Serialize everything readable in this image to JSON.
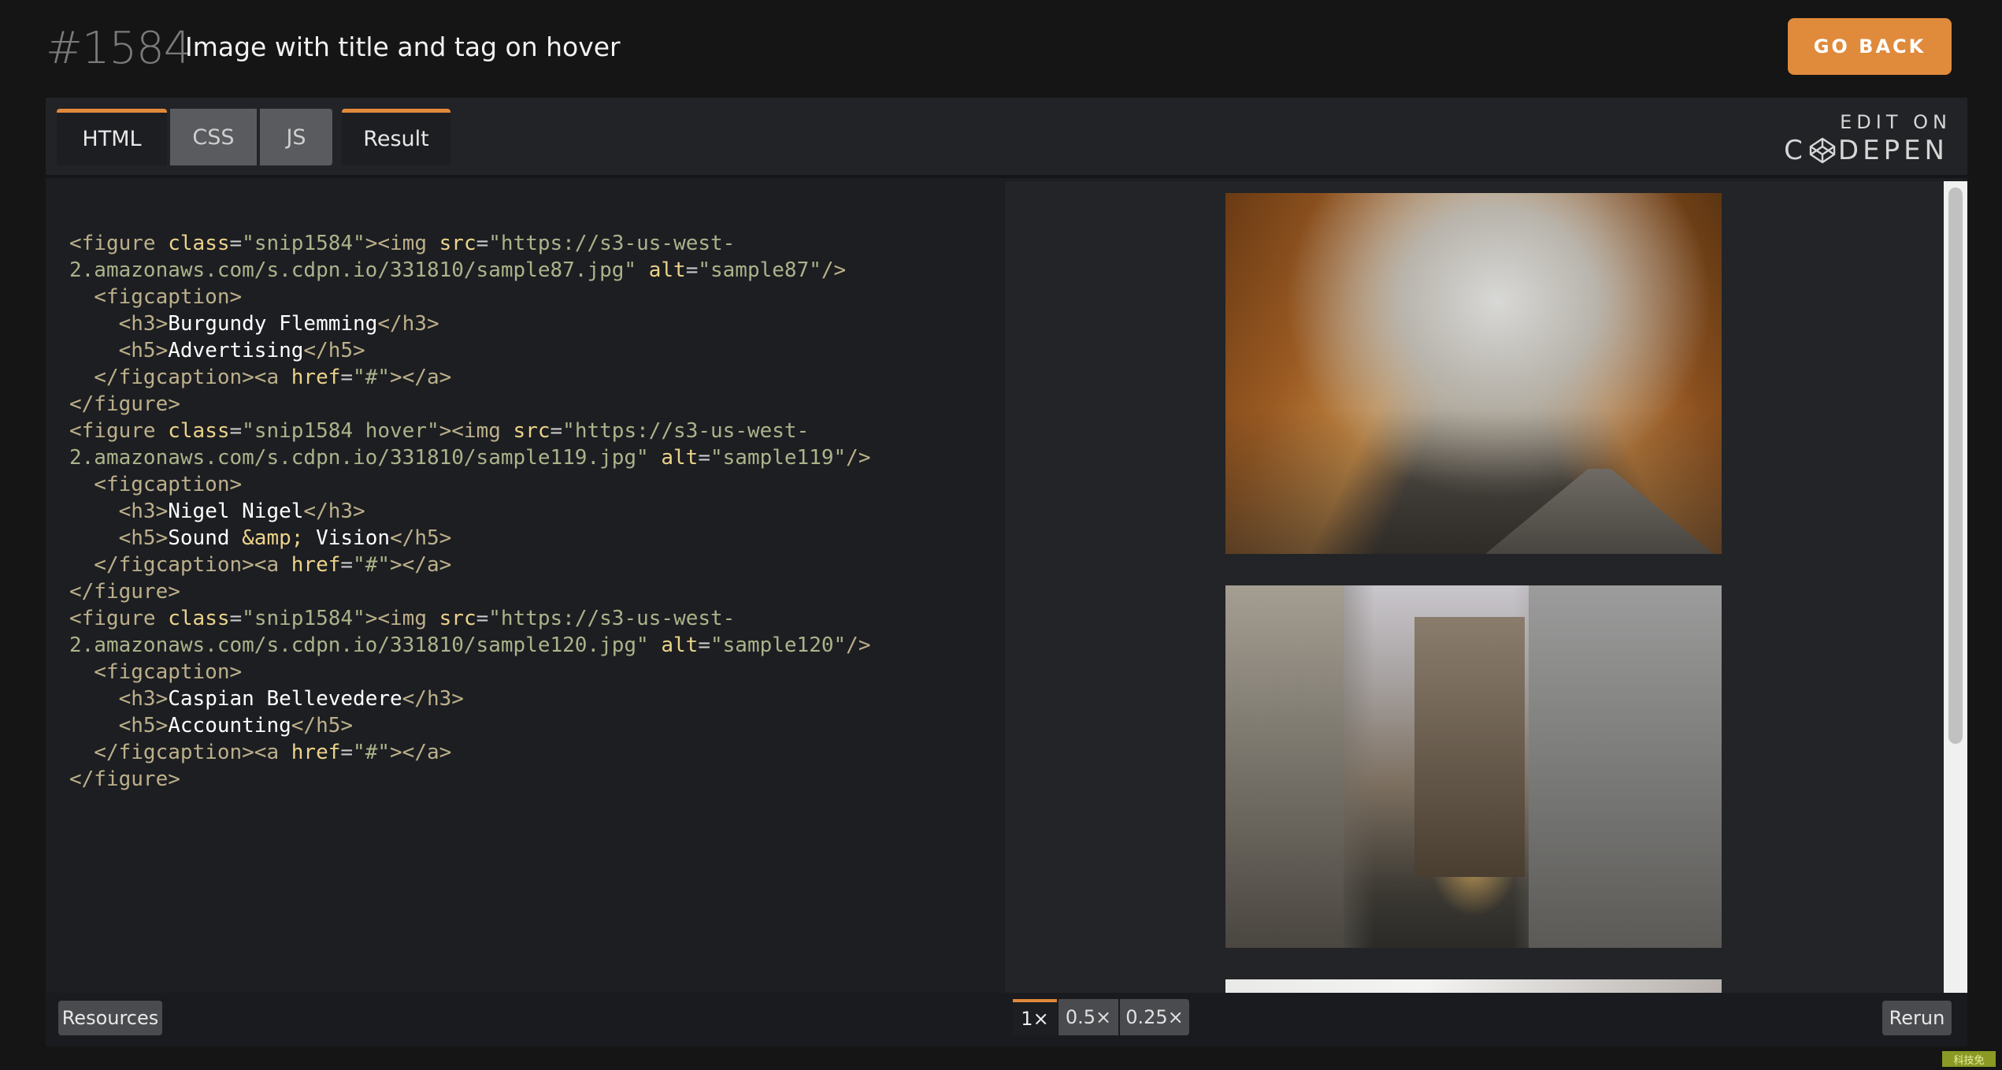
{
  "header": {
    "snippet_number": "#1584",
    "title": "Image with title and tag on hover",
    "go_back_label": "GO BACK"
  },
  "colors": {
    "accent": "#e08a3c",
    "background": "#151515",
    "panel": "#1d1e22"
  },
  "editor": {
    "tabs": [
      {
        "label": "HTML",
        "active": true
      },
      {
        "label": "CSS",
        "active": false
      },
      {
        "label": "JS",
        "active": false
      }
    ],
    "result_tab": "Result",
    "edit_on": "EDIT ON",
    "codepen_c": "C",
    "codepen_rest": "DEPEN"
  },
  "code_lines": [
    [
      [
        "tg",
        "<figure "
      ],
      [
        "at",
        "class"
      ],
      [
        "pl",
        "="
      ],
      [
        "st",
        "\"snip1584\""
      ],
      [
        "tg",
        "><img "
      ],
      [
        "at",
        "src"
      ],
      [
        "pl",
        "="
      ],
      [
        "st",
        "\"https://s3-us-west-"
      ]
    ],
    [
      [
        "st",
        "2.amazonaws.com/s.cdpn.io/331810/sample87.jpg\" "
      ],
      [
        "at",
        "alt"
      ],
      [
        "pl",
        "="
      ],
      [
        "st",
        "\"sample87\""
      ],
      [
        "tg",
        "/>"
      ]
    ],
    [
      [
        "tg",
        "  <figcaption>"
      ]
    ],
    [
      [
        "tg",
        "    <h3>"
      ],
      [
        "tx",
        "Burgundy Flemming"
      ],
      [
        "tg",
        "</h3>"
      ]
    ],
    [
      [
        "tg",
        "    <h5>"
      ],
      [
        "tx",
        "Advertising"
      ],
      [
        "tg",
        "</h5>"
      ]
    ],
    [
      [
        "tg",
        "  </figcaption><a "
      ],
      [
        "at",
        "href"
      ],
      [
        "pl",
        "="
      ],
      [
        "st",
        "\"#\""
      ],
      [
        "tg",
        "></a>"
      ]
    ],
    [
      [
        "tg",
        "</figure>"
      ]
    ],
    [
      [
        "tg",
        "<figure "
      ],
      [
        "at",
        "class"
      ],
      [
        "pl",
        "="
      ],
      [
        "st",
        "\"snip1584 hover\""
      ],
      [
        "tg",
        "><img "
      ],
      [
        "at",
        "src"
      ],
      [
        "pl",
        "="
      ],
      [
        "st",
        "\"https://s3-us-west-"
      ]
    ],
    [
      [
        "st",
        "2.amazonaws.com/s.cdpn.io/331810/sample119.jpg\" "
      ],
      [
        "at",
        "alt"
      ],
      [
        "pl",
        "="
      ],
      [
        "st",
        "\"sample119\""
      ],
      [
        "tg",
        "/>"
      ]
    ],
    [
      [
        "tg",
        "  <figcaption>"
      ]
    ],
    [
      [
        "tg",
        "    <h3>"
      ],
      [
        "tx",
        "Nigel Nigel"
      ],
      [
        "tg",
        "</h3>"
      ]
    ],
    [
      [
        "tg",
        "    <h5>"
      ],
      [
        "tx",
        "Sound "
      ],
      [
        "at",
        "&amp;"
      ],
      [
        "tx",
        " Vision"
      ],
      [
        "tg",
        "</h5>"
      ]
    ],
    [
      [
        "tg",
        "  </figcaption><a "
      ],
      [
        "at",
        "href"
      ],
      [
        "pl",
        "="
      ],
      [
        "st",
        "\"#\""
      ],
      [
        "tg",
        "></a>"
      ]
    ],
    [
      [
        "tg",
        "</figure>"
      ]
    ],
    [
      [
        "tg",
        "<figure "
      ],
      [
        "at",
        "class"
      ],
      [
        "pl",
        "="
      ],
      [
        "st",
        "\"snip1584\""
      ],
      [
        "tg",
        "><img "
      ],
      [
        "at",
        "src"
      ],
      [
        "pl",
        "="
      ],
      [
        "st",
        "\"https://s3-us-west-"
      ]
    ],
    [
      [
        "st",
        "2.amazonaws.com/s.cdpn.io/331810/sample120.jpg\" "
      ],
      [
        "at",
        "alt"
      ],
      [
        "pl",
        "="
      ],
      [
        "st",
        "\"sample120\""
      ],
      [
        "tg",
        "/>"
      ]
    ],
    [
      [
        "tg",
        "  <figcaption>"
      ]
    ],
    [
      [
        "tg",
        "    <h3>"
      ],
      [
        "tx",
        "Caspian Bellevedere"
      ],
      [
        "tg",
        "</h3>"
      ]
    ],
    [
      [
        "tg",
        "    <h5>"
      ],
      [
        "tx",
        "Accounting"
      ],
      [
        "tg",
        "</h5>"
      ]
    ],
    [
      [
        "tg",
        "  </figcaption><a "
      ],
      [
        "at",
        "href"
      ],
      [
        "pl",
        "="
      ],
      [
        "st",
        "\"#\""
      ],
      [
        "tg",
        "></a>"
      ]
    ],
    [
      [
        "tg",
        "</figure>"
      ]
    ]
  ],
  "bottom_bar": {
    "resources_label": "Resources",
    "zoom_levels": [
      "1×",
      "0.5×",
      "0.25×"
    ],
    "rerun_label": "Rerun"
  },
  "corner_badge": "科技免"
}
